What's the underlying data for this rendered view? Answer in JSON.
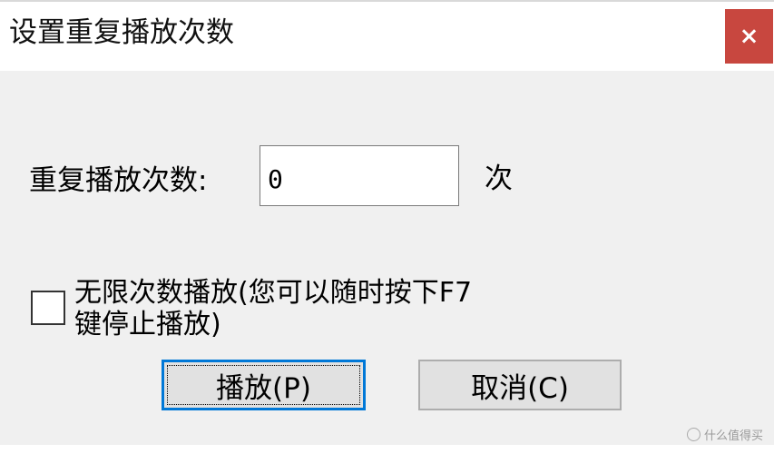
{
  "dialog": {
    "title": "设置重复播放次数",
    "close_label": "×"
  },
  "repeat": {
    "label": "重复播放次数:",
    "value": "0",
    "unit": "次"
  },
  "infinite": {
    "checked": false,
    "label_line1": "无限次数播放(您可以随时按下F7",
    "label_line2": "键停止播放)"
  },
  "buttons": {
    "play_label": "播放(P)",
    "cancel_label": "取消(C)"
  },
  "watermark": {
    "text": "什么值得买"
  },
  "colors": {
    "close_button": "#c8473f",
    "focus_border": "#0078d7",
    "dialog_bg": "#f0f0f0"
  },
  "icons": {
    "close": "close-icon",
    "checkbox": "checkbox-icon",
    "watermark": "smzdm-logo-icon"
  }
}
